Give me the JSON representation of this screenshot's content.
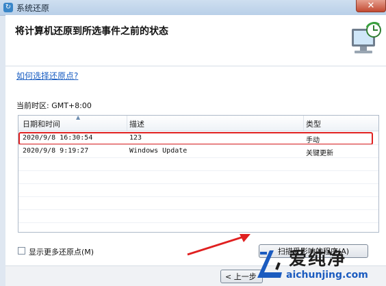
{
  "window": {
    "title": "系统还原",
    "close_label": "✕"
  },
  "header": {
    "title": "将计算机还原到所选事件之前的状态"
  },
  "help_link": "如何选择还原点?",
  "timezone_label": "当前时区: GMT+8:00",
  "table": {
    "columns": [
      "日期和时间",
      "描述",
      "类型"
    ],
    "rows": [
      {
        "datetime": "2020/9/8 16:30:54",
        "description": "123",
        "type": "手动",
        "highlighted": true
      },
      {
        "datetime": "2020/9/8 9:19:27",
        "description": "Windows Update",
        "type": "关键更新",
        "highlighted": false
      }
    ]
  },
  "show_more_checkbox": {
    "label": "显示更多还原点(M)",
    "checked": false
  },
  "scan_button": "扫描受影响的程序(A)",
  "prev_button": "< 上一步",
  "watermark": {
    "brand": "爱纯净",
    "url": "aichunjing.com"
  },
  "colors": {
    "highlight": "#e02020",
    "link": "#1a5ec2",
    "annotation_arrow": "#e02020"
  }
}
